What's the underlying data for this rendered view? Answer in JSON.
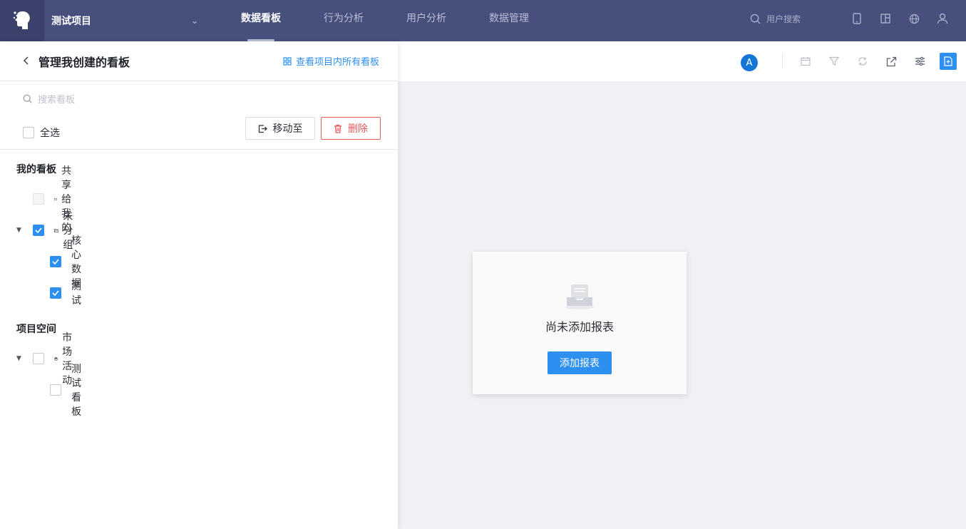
{
  "topbar": {
    "project_name": "测试项目",
    "nav": [
      {
        "label": "数据看板",
        "active": true
      },
      {
        "label": "行为分析",
        "active": false
      },
      {
        "label": "用户分析",
        "active": false
      },
      {
        "label": "数据管理",
        "active": false
      }
    ],
    "search_placeholder": "用户搜索",
    "icons": [
      "mobile-icon",
      "layout-icon",
      "globe-icon",
      "user-icon"
    ]
  },
  "panel": {
    "title": "管理我创建的看板",
    "view_all": "查看项目内所有看板",
    "search_placeholder": "搜索看板",
    "select_all": "全选",
    "move_to": "移动至",
    "delete": "删除",
    "my_boards_title": "我的看板",
    "shared_to_me": "共享给我的",
    "ungrouped": "未分组",
    "board_core": "核心数据",
    "board_test": "测试",
    "project_space_title": "项目空间",
    "market_activity": "市场活动",
    "board_test_board": "测试看板"
  },
  "content": {
    "avatar_letter": "A",
    "tools": [
      "calendar-icon",
      "filter-icon",
      "refresh-icon",
      "export-icon",
      "settings-sliders-icon",
      "add-report-icon"
    ],
    "empty_text": "尚未添加报表",
    "add_report": "添加报表"
  },
  "colors": {
    "topbar_bg": "#474f7d",
    "accent": "#2d8ff0",
    "danger": "#e85a5a"
  }
}
